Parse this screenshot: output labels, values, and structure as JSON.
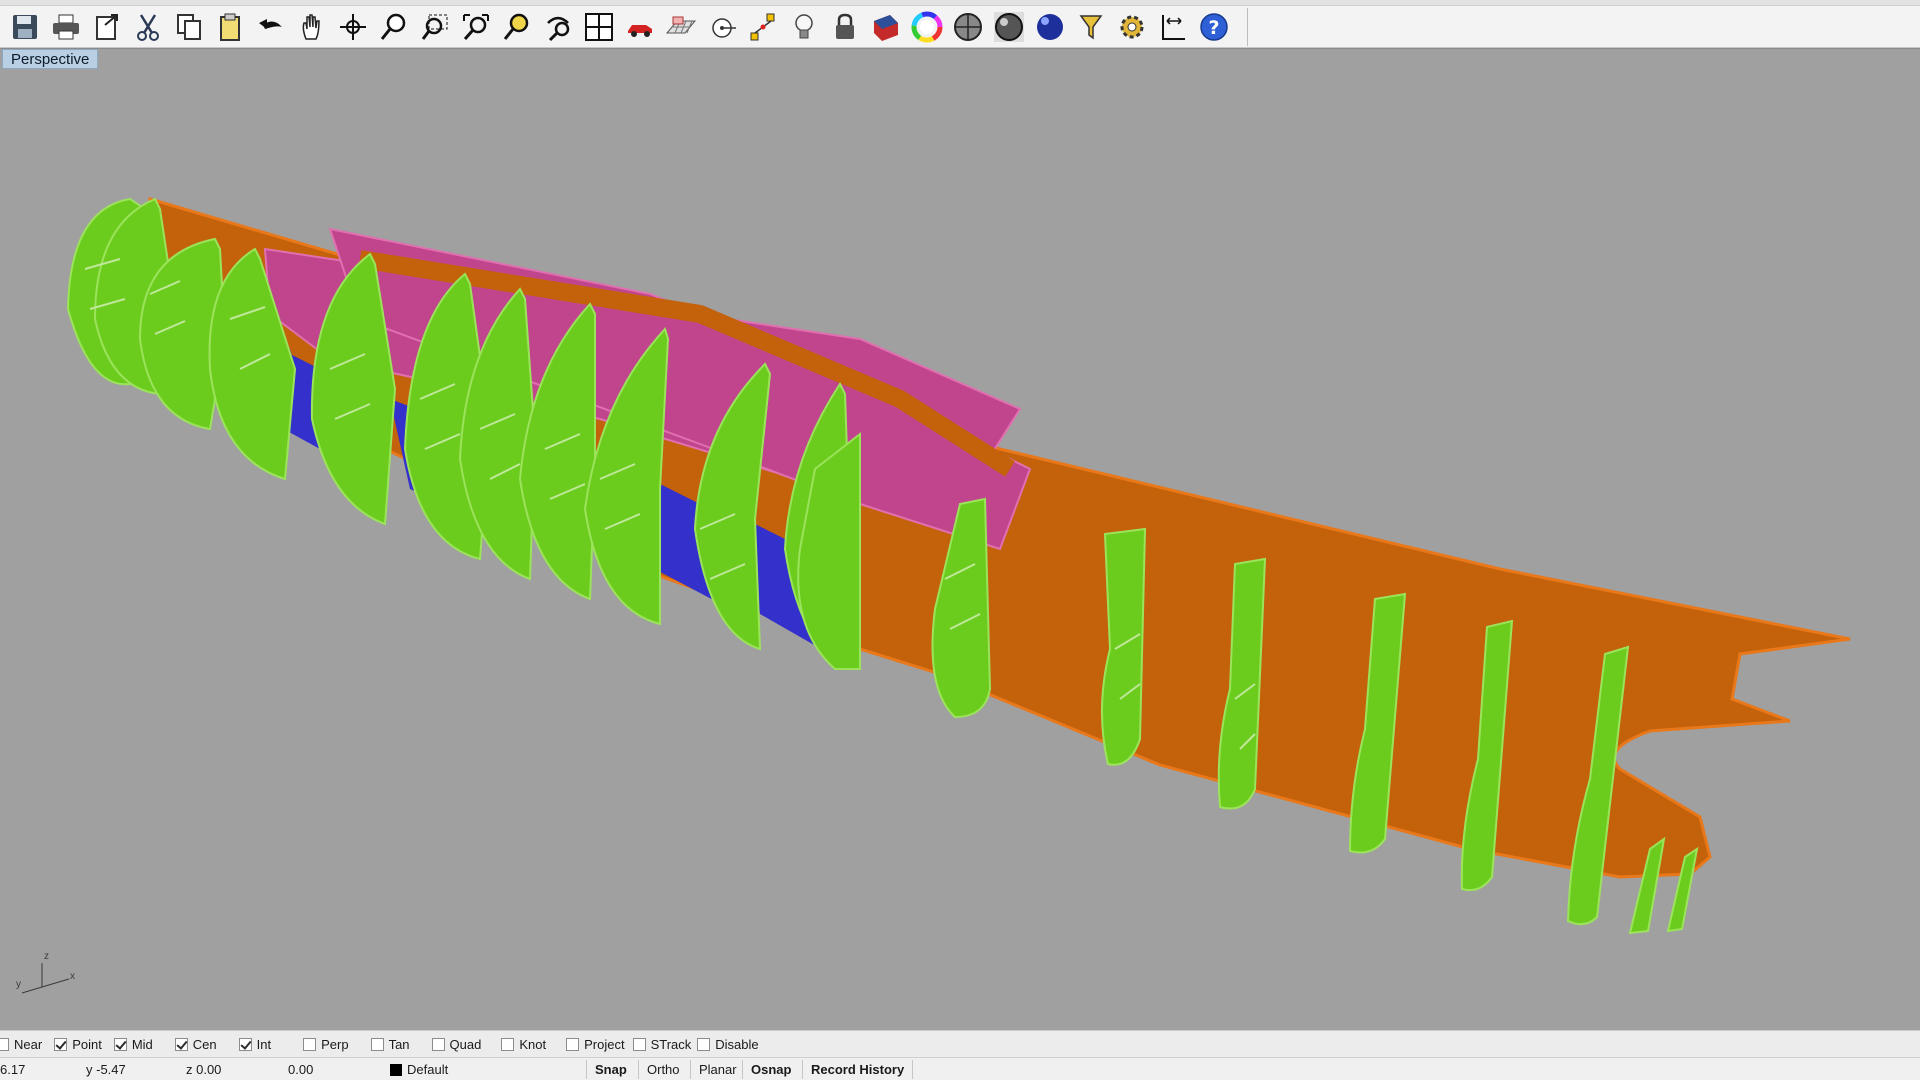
{
  "toolbar": {
    "icons": [
      "save-icon",
      "print-icon",
      "export-icon",
      "cut-icon",
      "copy-icon",
      "paste-icon",
      "undo-icon",
      "pan-hand-icon",
      "rotate-view-icon",
      "zoom-dynamic-icon",
      "zoom-window-icon",
      "zoom-extents-icon",
      "zoom-selected-icon",
      "undo-view-icon",
      "four-viewports-icon",
      "car-render-icon",
      "grid-plane-icon",
      "point-snap-icon",
      "select-points-icon",
      "light-bulb-icon",
      "lock-icon",
      "shaded-object-icon",
      "color-wheel-icon",
      "shaded-sphere-icon",
      "render-sphere-icon",
      "blue-sphere-icon",
      "select-filter-icon",
      "options-gear-icon",
      "dimension-icon",
      "help-icon"
    ]
  },
  "viewport": {
    "title": "Perspective",
    "colors": {
      "background": "#a0a0a0",
      "bulkheads": "#6ccc1e",
      "keel": "#c4620b",
      "girders": "#c0458c",
      "bottom_plates": "#3330cc"
    },
    "axes": {
      "z": "z",
      "x": "x",
      "y": "y"
    }
  },
  "osnap": {
    "items": [
      {
        "label": "Near",
        "checked": false
      },
      {
        "label": "Point",
        "checked": true
      },
      {
        "label": "Mid",
        "checked": true
      },
      {
        "label": "Cen",
        "checked": true
      },
      {
        "label": "Int",
        "checked": true
      },
      {
        "label": "Perp",
        "checked": false
      },
      {
        "label": "Tan",
        "checked": false
      },
      {
        "label": "Quad",
        "checked": false
      },
      {
        "label": "Knot",
        "checked": false
      },
      {
        "label": "Project",
        "checked": false
      },
      {
        "label": "STrack",
        "checked": false
      },
      {
        "label": "Disable",
        "checked": false
      }
    ]
  },
  "status": {
    "x": "6.17",
    "y": "y -5.47",
    "z": "z 0.00",
    "distance": "0.00",
    "layer": "Default",
    "layer_color": "#000000",
    "panes": [
      "Snap",
      "Ortho",
      "Planar",
      "Osnap",
      "Record History"
    ]
  }
}
